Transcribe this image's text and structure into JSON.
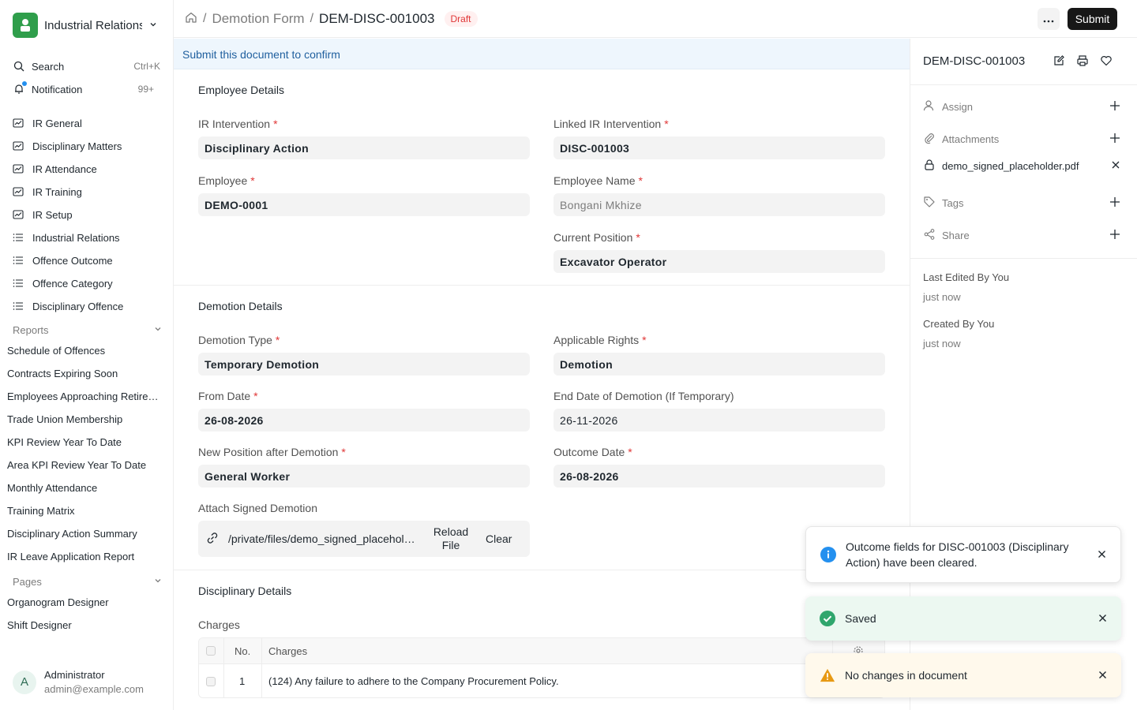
{
  "app": {
    "name": "Industrial Relations"
  },
  "sidebar": {
    "search_label": "Search",
    "search_shortcut": "Ctrl+K",
    "notification_label": "Notification",
    "notification_count": "99+",
    "workspaces": [
      {
        "label": "IR General",
        "icon": "dashboard-icon"
      },
      {
        "label": "Disciplinary Matters",
        "icon": "dashboard-icon"
      },
      {
        "label": "IR Attendance",
        "icon": "dashboard-icon"
      },
      {
        "label": "IR Training",
        "icon": "dashboard-icon"
      },
      {
        "label": "IR Setup",
        "icon": "dashboard-icon"
      },
      {
        "label": "Industrial Relations",
        "icon": "list-icon"
      },
      {
        "label": "Offence Outcome",
        "icon": "list-icon"
      },
      {
        "label": "Offence Category",
        "icon": "list-icon"
      },
      {
        "label": "Disciplinary Offence",
        "icon": "list-icon"
      }
    ],
    "reports_header": "Reports",
    "reports": [
      "Schedule of Offences",
      "Contracts Expiring Soon",
      "Employees Approaching Retirement",
      "Trade Union Membership",
      "KPI Review Year To Date",
      "Area KPI Review Year To Date",
      "Monthly Attendance",
      "Training Matrix",
      "Disciplinary Action Summary",
      "IR Leave Application Report"
    ],
    "pages_header": "Pages",
    "pages": [
      "Organogram Designer",
      "Shift Designer"
    ],
    "user": {
      "initial": "A",
      "name": "Administrator",
      "email": "admin@example.com"
    }
  },
  "topbar": {
    "breadcrumb_parent": "Demotion Form",
    "breadcrumb_current": "DEM-DISC-001003",
    "status_badge": "Draft",
    "submit_label": "Submit"
  },
  "form": {
    "banner": "Submit this document to confirm",
    "employee_section": {
      "title": "Employee Details",
      "ir_intervention": {
        "label": "IR Intervention",
        "value": "Disciplinary Action"
      },
      "linked_ir_intervention": {
        "label": "Linked IR Intervention",
        "value": "DISC-001003"
      },
      "employee": {
        "label": "Employee",
        "value": "DEMO-0001"
      },
      "employee_name": {
        "label": "Employee Name",
        "value": "Bongani Mkhize"
      },
      "current_position": {
        "label": "Current Position",
        "value": "Excavator Operator"
      }
    },
    "demotion_section": {
      "title": "Demotion Details",
      "demotion_type": {
        "label": "Demotion Type",
        "value": "Temporary Demotion"
      },
      "applicable_rights": {
        "label": "Applicable Rights",
        "value": "Demotion"
      },
      "from_date": {
        "label": "From Date",
        "value": "26-08-2026"
      },
      "end_date": {
        "label": "End Date of Demotion (If Temporary)",
        "value": "26-11-2026"
      },
      "new_position": {
        "label": "New Position after Demotion",
        "value": "General Worker"
      },
      "outcome_date": {
        "label": "Outcome Date",
        "value": "26-08-2026"
      },
      "attach": {
        "label": "Attach Signed Demotion",
        "path": "/private/files/demo_signed_placeholder.pdf",
        "reload_label": "Reload File",
        "clear_label": "Clear"
      }
    },
    "disciplinary_section": {
      "title": "Disciplinary Details",
      "charges_label": "Charges",
      "table_headers": {
        "no": "No.",
        "charges": "Charges"
      },
      "rows": [
        {
          "no": "1",
          "charges": "(124) Any failure to adhere to the Company Procurement Policy."
        }
      ]
    }
  },
  "right_panel": {
    "doc_name": "DEM-DISC-001003",
    "assign_label": "Assign",
    "attachments_label": "Attachments",
    "attachment_file": "demo_signed_placeholder.pdf",
    "tags_label": "Tags",
    "share_label": "Share",
    "last_edited_label": "Last Edited By You",
    "last_edited_time": "just now",
    "created_label": "Created By You",
    "created_time": "just now"
  },
  "toasts": [
    {
      "type": "info",
      "message": "Outcome fields for DISC-001003 (Disciplinary Action) have been cleared.",
      "color": "#ffffff",
      "icon_color": "#2490ef"
    },
    {
      "type": "success",
      "message": "Saved",
      "color": "#ecf8f1",
      "icon_color": "#30a66d"
    },
    {
      "type": "warning",
      "message": "No changes in document",
      "color": "#fff9ec",
      "icon_color": "#e79913"
    }
  ]
}
